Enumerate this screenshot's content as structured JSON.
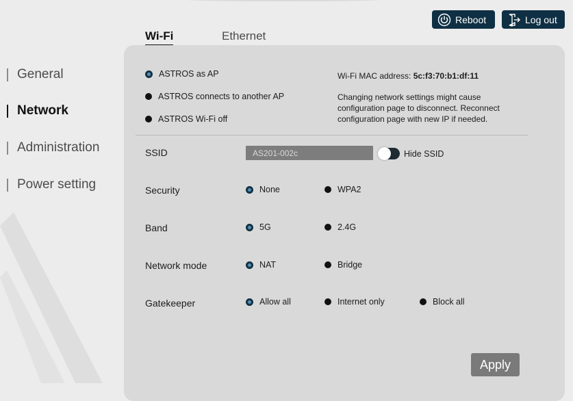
{
  "header": {
    "reboot_label": "Reboot",
    "reboot_icon": "power-icon",
    "logout_label": "Log out",
    "logout_icon": "logout-icon",
    "button_color": "#0f3044"
  },
  "tabs": [
    {
      "label": "Wi-Fi",
      "active": true
    },
    {
      "label": "Ethernet",
      "active": false
    }
  ],
  "sidebar": {
    "items": [
      {
        "label": "General",
        "active": false
      },
      {
        "label": "Network",
        "active": true
      },
      {
        "label": "Administration",
        "active": false
      },
      {
        "label": "Power setting",
        "active": false
      }
    ]
  },
  "wifi_mode": {
    "options": [
      {
        "label": "ASTROS as AP",
        "selected": true
      },
      {
        "label": "ASTROS connects to another AP",
        "selected": false
      },
      {
        "label": "ASTROS Wi-Fi off",
        "selected": false
      }
    ]
  },
  "info": {
    "mac_label": "Wi-Fi MAC address:",
    "mac_value": "5c:f3:70:b1:df:11",
    "note_line1": "Changing network settings might cause",
    "note_line2": "configuration page to disconnect. Reconnect",
    "note_line3": "configuration page with new IP if needed."
  },
  "ssid": {
    "label": "SSID",
    "value": "AS201-002c",
    "hide_label": "Hide SSID",
    "hide_enabled": false
  },
  "security": {
    "label": "Security",
    "options": [
      "None",
      "WPA2"
    ],
    "selected": "None"
  },
  "band": {
    "label": "Band",
    "options": [
      "5G",
      "2.4G"
    ],
    "selected": "5G"
  },
  "network_mode": {
    "label": "Network mode",
    "options": [
      "NAT",
      "Bridge"
    ],
    "selected": "NAT"
  },
  "gatekeeper": {
    "label": "Gatekeeper",
    "options": [
      "Allow all",
      "Internet only",
      "Block all"
    ],
    "selected": "Allow all"
  },
  "apply_label": "Apply"
}
